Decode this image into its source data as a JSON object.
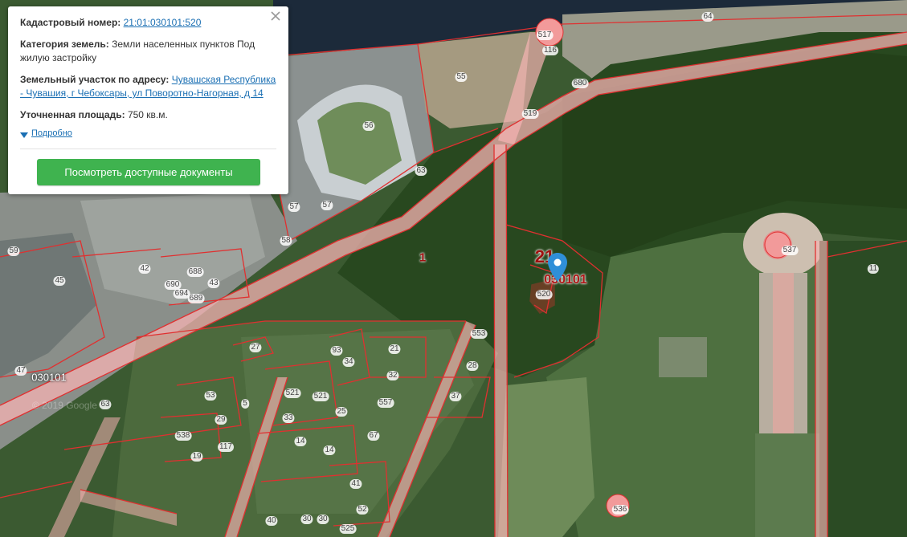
{
  "popup": {
    "cadastral_label": "Кадастровый номер:",
    "cadastral_value": "21:01:030101:520",
    "category_label": "Категория земель:",
    "category_value": "Земли населенных пунктов Под жилую застройку",
    "address_label": "Земельный участок по адресу:",
    "address_value": "Чувашская Республика - Чувашия, г Чебоксары, ул Поворотно-Нагорная, д 14",
    "area_label": "Уточненная площадь:",
    "area_value": "750 кв.м.",
    "more_label": "Подробно",
    "button_label": "Посмотреть доступные документы",
    "close_icon": "close-icon"
  },
  "map": {
    "block_labels": {
      "quarter_big": "21",
      "quarter_number": "030101",
      "quarter_number_left": "030101",
      "area_1": "1"
    },
    "parcel_labels": [
      "64",
      "116",
      "517",
      "55",
      "680",
      "519",
      "56",
      "63",
      "57",
      "57",
      "58",
      "59",
      "45",
      "42",
      "688",
      "43",
      "689",
      "690",
      "694",
      "537",
      "11",
      "520",
      "553",
      "27",
      "21",
      "34",
      "32",
      "28",
      "557",
      "37",
      "47",
      "63",
      "53",
      "521",
      "521",
      "25",
      "29",
      "33",
      "538",
      "117",
      "19",
      "14",
      "14",
      "67",
      "41",
      "52",
      "40",
      "30",
      "30",
      "525",
      "536",
      "93",
      "5"
    ],
    "watermark": "© 2019 Google",
    "colors": {
      "boundary": "#e03030",
      "road_fill": "#f6b3b3",
      "button": "#3fb34f",
      "link": "#1a6fb3",
      "water": "#1c2a3a"
    }
  }
}
